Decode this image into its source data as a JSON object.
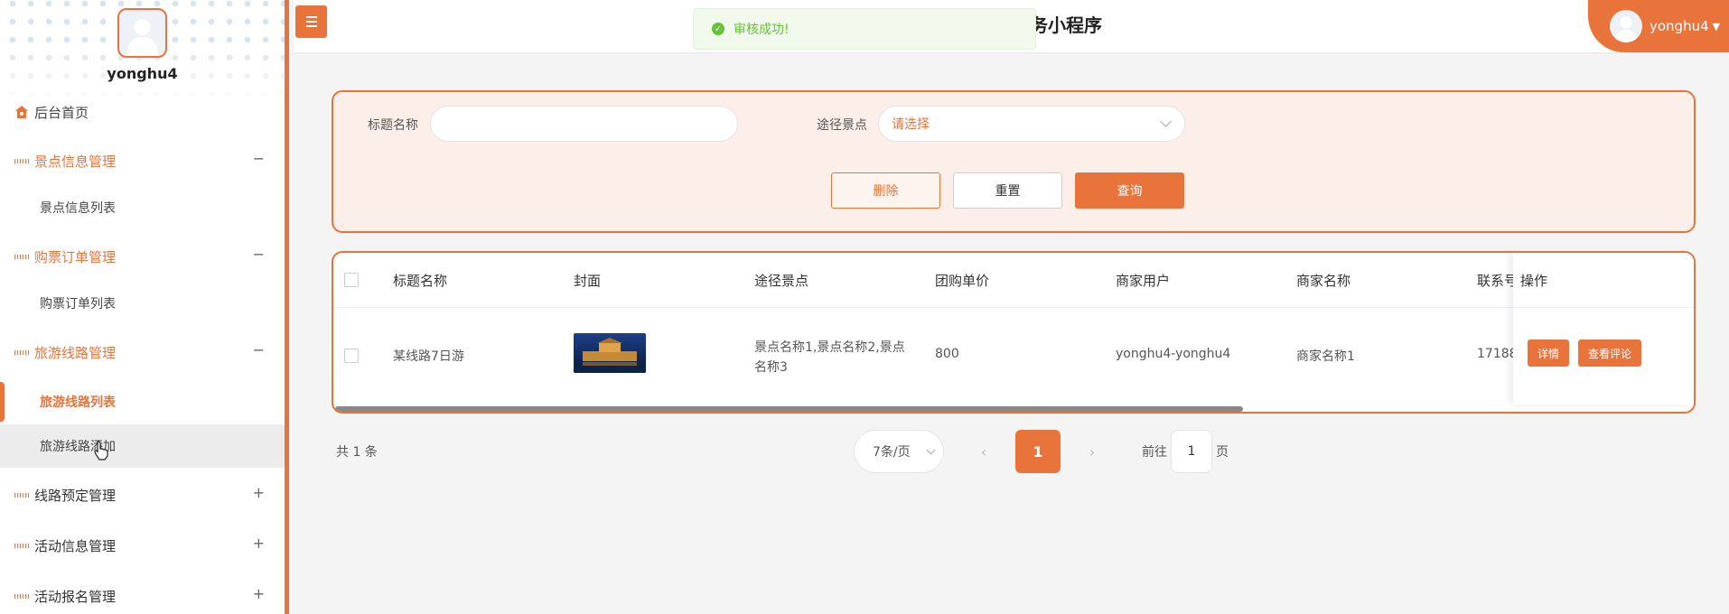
{
  "sidebar": {
    "username": "yonghu4",
    "home": "后台首页",
    "groups": [
      {
        "label": "景点信息管理",
        "toggle": "−",
        "sub": "景点信息列表"
      },
      {
        "label": "购票订单管理",
        "toggle": "−",
        "sub": "购票订单列表"
      },
      {
        "label": "旅游线路管理",
        "toggle": "−",
        "sub_active": "旅游线路列表",
        "sub_hover": "旅游线路添加"
      },
      {
        "label": "线路预定管理",
        "toggle": "+"
      },
      {
        "label": "活动信息管理",
        "toggle": "+"
      },
      {
        "label": "活动报名管理",
        "toggle": "+"
      }
    ]
  },
  "header": {
    "title": "务小程序",
    "user": "yonghu4",
    "toast": "审核成功!"
  },
  "search": {
    "title_label": "标题名称",
    "title_value": "",
    "route_label": "途径景点",
    "route_placeholder": "请选择",
    "delete": "删除",
    "reset": "重置",
    "query": "查询"
  },
  "table": {
    "headers": [
      "标题名称",
      "封面",
      "途径景点",
      "团购单价",
      "商家用户",
      "商家名称",
      "联系号",
      "操作"
    ],
    "rows": [
      {
        "title": "某线路7日游",
        "route": "景点名称1,景点名称2,景点名称3",
        "price": "800",
        "merchant_user": "yonghu4-yonghu4",
        "merchant_name": "商家名称1",
        "phone": "17188",
        "detail": "详情",
        "review": "查看评论"
      }
    ]
  },
  "pager": {
    "total": "共 1 条",
    "size": "7条/页",
    "current": "1",
    "goto_prefix": "前往",
    "goto_value": "1",
    "goto_suffix": "页"
  },
  "colors": {
    "accent": "#e8743b",
    "success": "#67c23a"
  }
}
